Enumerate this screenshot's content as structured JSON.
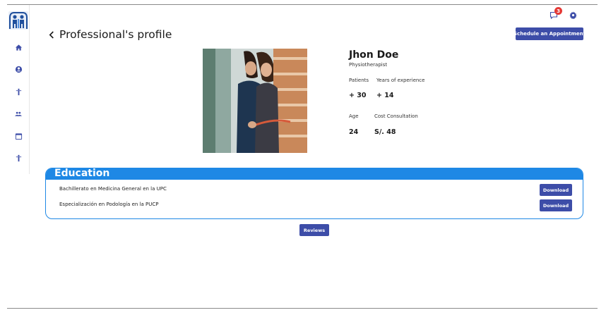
{
  "header": {
    "page_title": "Professional's profile",
    "notification_count": "3",
    "schedule_button": "Schedule an Appointment"
  },
  "sidebar": {
    "items": [
      {
        "name": "home",
        "icon": "home-icon"
      },
      {
        "name": "account",
        "icon": "account-circle-icon"
      },
      {
        "name": "accessibility",
        "icon": "person-icon"
      },
      {
        "name": "group",
        "icon": "group-icon"
      },
      {
        "name": "calendar",
        "icon": "calendar-icon"
      },
      {
        "name": "accessibility-2",
        "icon": "person-icon"
      }
    ]
  },
  "profile": {
    "name": "Jhon Doe",
    "role": "Physiotherapist",
    "patients_label": "Patients",
    "patients_value": "+ 30",
    "experience_label": "Years of experience",
    "experience_value": "+ 14",
    "age_label": "Age",
    "age_value": "24",
    "cost_label": "Cost Consultation",
    "cost_value": "S/. 48"
  },
  "education": {
    "title": "Education",
    "items": [
      {
        "text": "Bachillerato en Medicina General en la UPC",
        "button": "Download"
      },
      {
        "text": "Especialización en Podología en la PUCP",
        "button": "Download"
      }
    ]
  },
  "reviews_button": "Reviews",
  "colors": {
    "primary": "#3d4da8",
    "education_blue": "#1e88e5",
    "badge": "#e53935"
  }
}
